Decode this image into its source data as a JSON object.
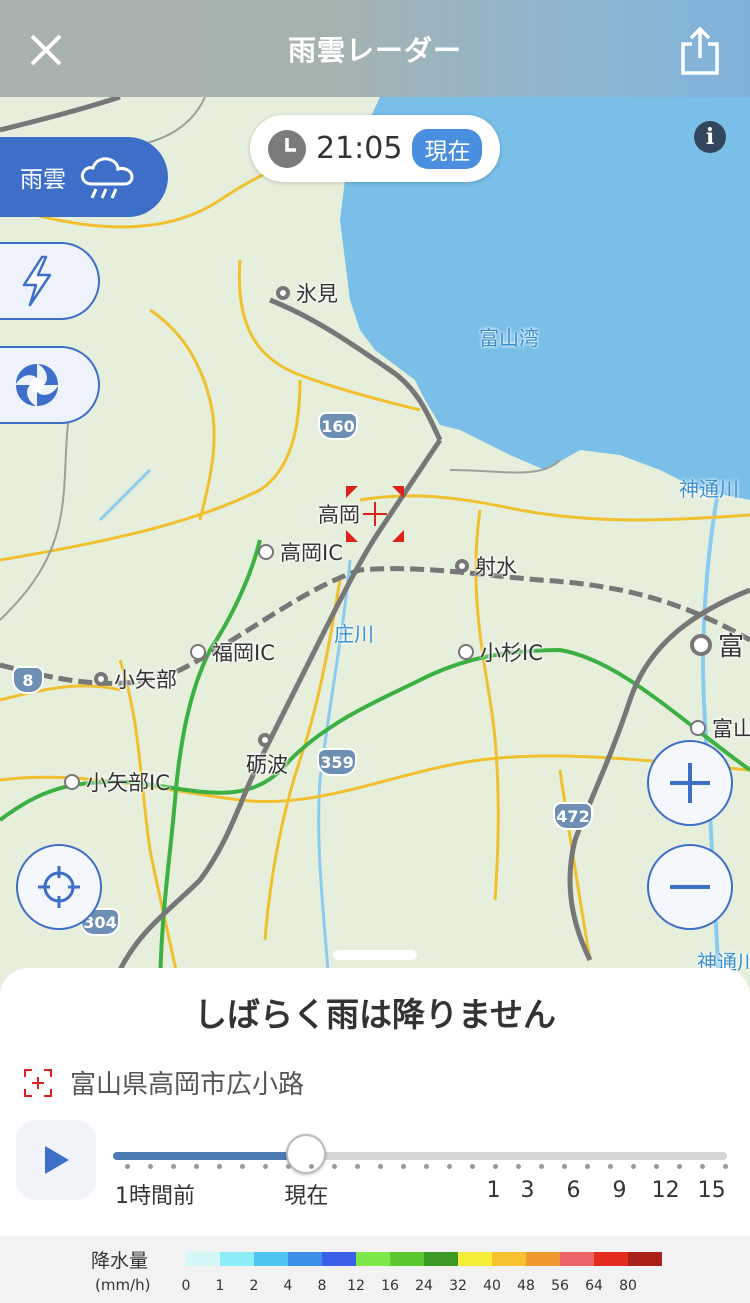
{
  "header": {
    "title": "雨雲レーダー",
    "close_icon": "close-icon",
    "share_icon": "share-icon"
  },
  "time": {
    "value": "21:05",
    "badge": "現在"
  },
  "side_buttons": {
    "rain_label": "雨雲",
    "rain_icon": "rain-cloud-icon",
    "lightning_icon": "lightning-icon",
    "typhoon_icon": "typhoon-icon"
  },
  "map": {
    "places": [
      {
        "name": "氷見"
      },
      {
        "name": "高岡"
      },
      {
        "name": "高岡IC"
      },
      {
        "name": "射水"
      },
      {
        "name": "福岡IC"
      },
      {
        "name": "小杉IC"
      },
      {
        "name": "小矢部"
      },
      {
        "name": "砺波"
      },
      {
        "name": "小矢部IC"
      },
      {
        "name": "富"
      },
      {
        "name": "富山"
      }
    ],
    "water": {
      "bay": "富山湾",
      "river1": "庄川",
      "river2": "神通川",
      "river3": "神通川"
    },
    "routes": [
      "160",
      "8",
      "359",
      "472",
      "304"
    ]
  },
  "sheet": {
    "forecast": "しばらく雨は降りません",
    "location": "富山県高岡市広小路",
    "slider": {
      "value_percent": 31.5,
      "labels": [
        {
          "text": "1時間前",
          "pos": 0
        },
        {
          "text": "現在",
          "pos": 31.5
        },
        {
          "text": "1",
          "pos": 62
        },
        {
          "text": "3",
          "pos": 67.5
        },
        {
          "text": "6",
          "pos": 75
        },
        {
          "text": "9",
          "pos": 82.5
        },
        {
          "text": "12",
          "pos": 90
        },
        {
          "text": "15",
          "pos": 97.5
        }
      ]
    }
  },
  "legend": {
    "title": "降水量",
    "unit": "(mm/h)",
    "colors": [
      "#d4f8f8",
      "#8cecf7",
      "#4fc3f2",
      "#3b8fe8",
      "#3b5fe8",
      "#7ee84a",
      "#5cc830",
      "#3e9a26",
      "#f6ec3a",
      "#f6c230",
      "#ef9a30",
      "#ea6468",
      "#e42c1e",
      "#a9201a"
    ],
    "values": [
      "0",
      "1",
      "2",
      "4",
      "8",
      "12",
      "16",
      "24",
      "32",
      "40",
      "48",
      "56",
      "64",
      "80"
    ]
  }
}
